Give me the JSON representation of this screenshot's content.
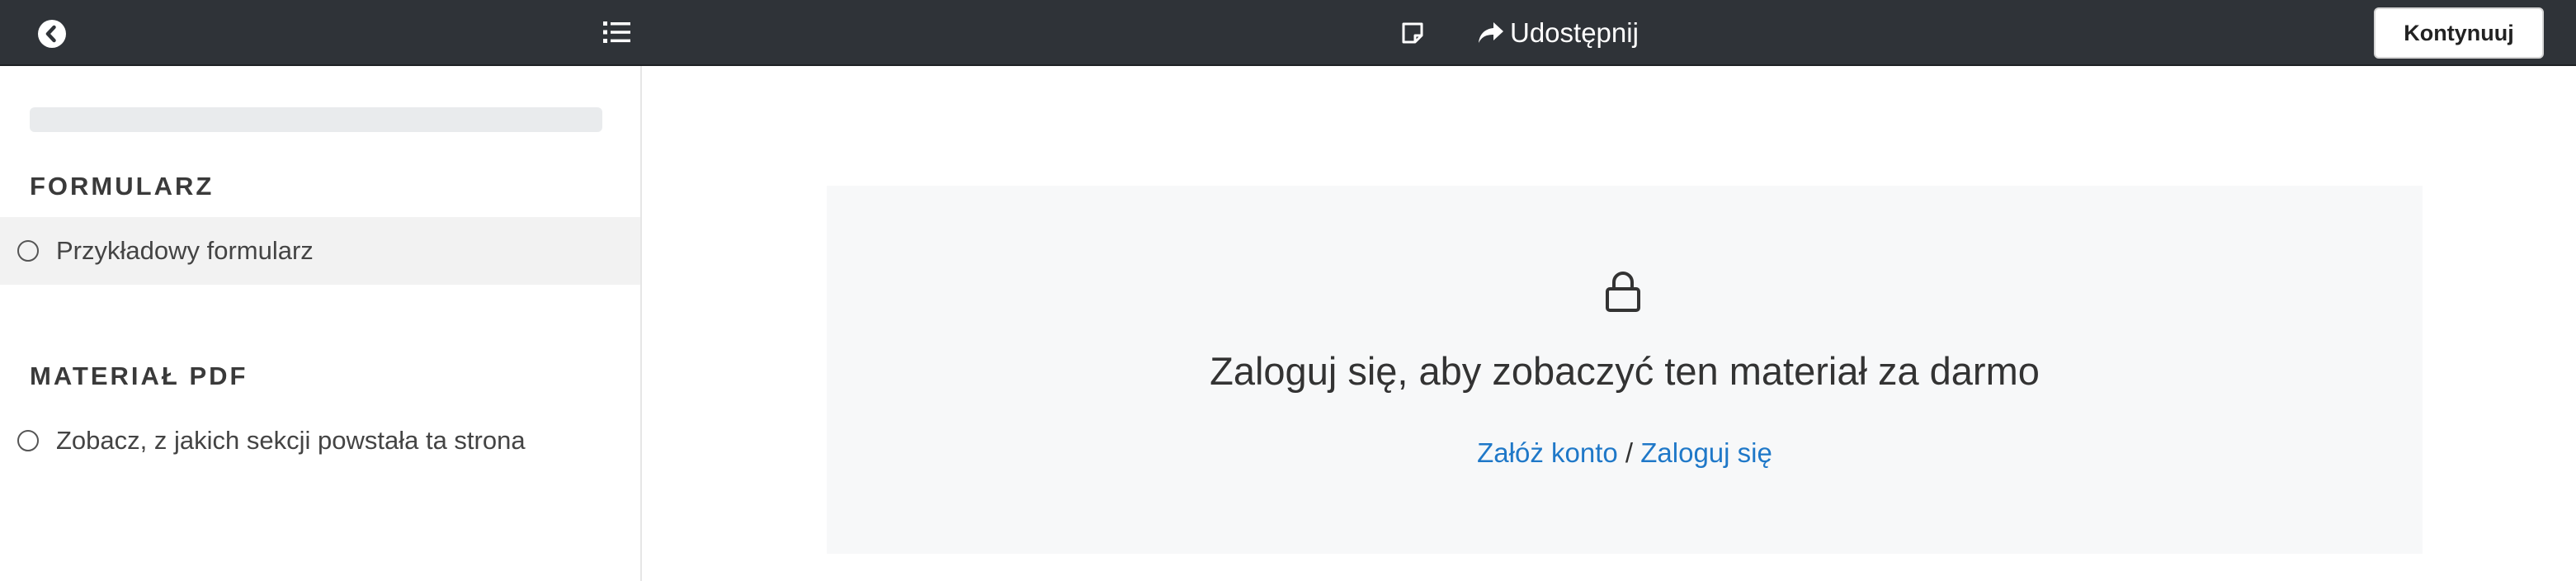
{
  "topbar": {
    "back_icon": "back-circle-icon",
    "list_icon": "list-icon",
    "note_icon": "note-icon",
    "share_icon": "share-arrow-icon",
    "share_label": "Udostępnij",
    "continue_label": "Kontynuuj",
    "colors": {
      "background": "#2f3338",
      "text": "#ffffff"
    }
  },
  "sidebar": {
    "sections": [
      {
        "heading": "FORMULARZ",
        "items": [
          {
            "label": "Przykładowy formularz",
            "selected": true
          }
        ]
      },
      {
        "heading": "MATERIAŁ PDF",
        "items": [
          {
            "label": "Zobacz, z jakich sekcji powstała ta strona",
            "selected": false
          }
        ]
      }
    ]
  },
  "main": {
    "lock_icon": "lock-icon",
    "title": "Zaloguj się, aby zobaczyć ten materiał za darmo",
    "register_link": "Załóż konto",
    "separator": "/",
    "login_link": "Zaloguj się",
    "colors": {
      "panel": "#f7f8f9",
      "link": "#1f78c8"
    }
  }
}
